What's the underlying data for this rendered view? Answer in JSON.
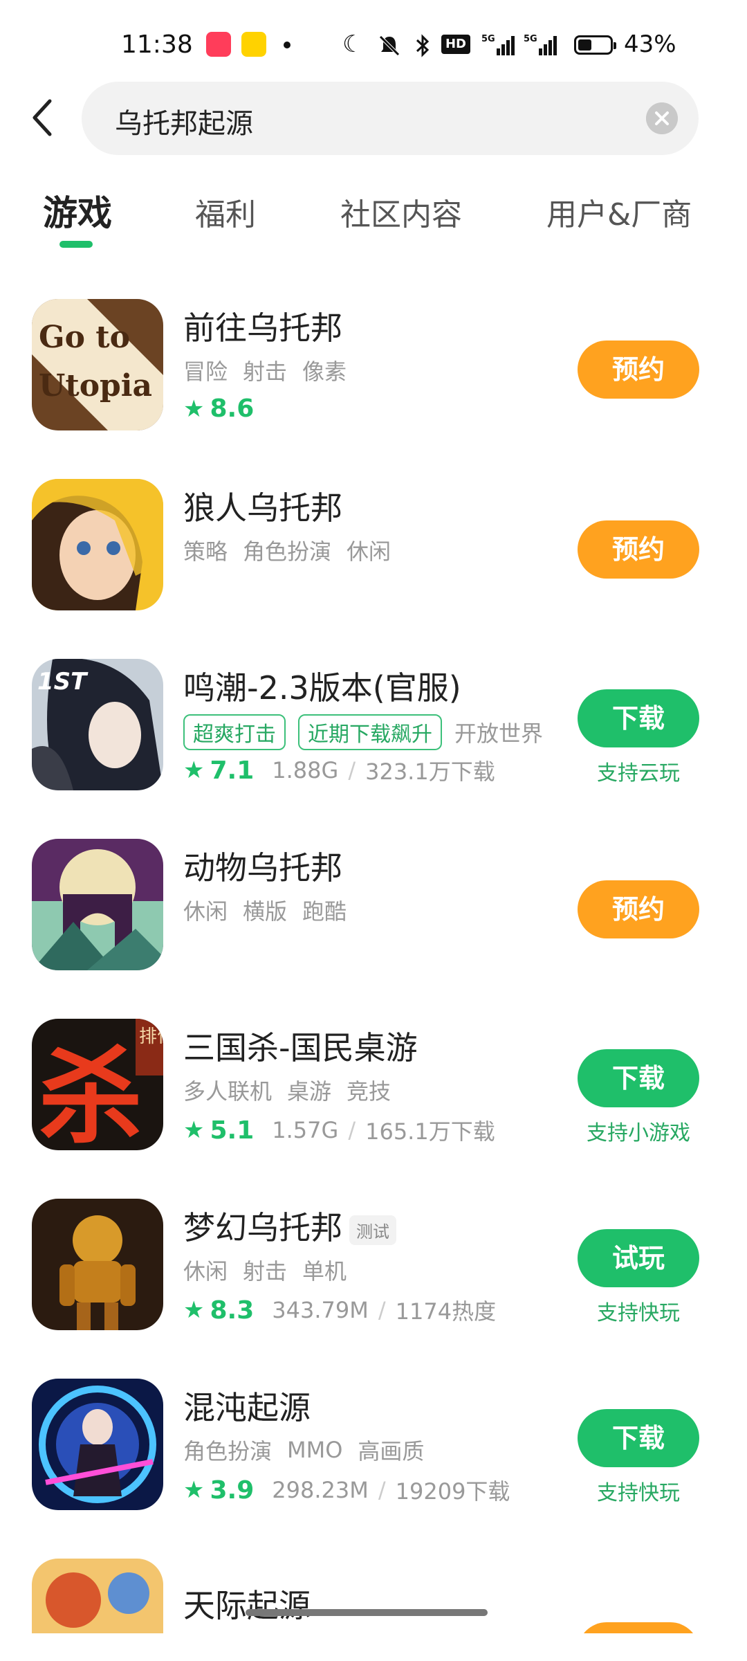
{
  "status_bar": {
    "time": "11:38",
    "hd_label": "HD",
    "battery_level": 0.43,
    "battery_text": "43%"
  },
  "search": {
    "query": "乌托邦起源"
  },
  "tabs": [
    {
      "label": "游戏",
      "active": true
    },
    {
      "label": "福利",
      "active": false
    },
    {
      "label": "社区内容",
      "active": false
    },
    {
      "label": "用户&厂商",
      "active": false
    }
  ],
  "apps": [
    {
      "name": "前往乌托邦",
      "tags": [
        "冒险",
        "射击",
        "像素"
      ],
      "rating": "8.6",
      "button": "预约"
    },
    {
      "name": "狼人乌托邦",
      "tags": [
        "策略",
        "角色扮演",
        "休闲"
      ],
      "button": "预约"
    },
    {
      "name": "鸣潮-2.3版本(官服)",
      "badges": [
        "超爽打击",
        "近期下载飙升"
      ],
      "tags": [
        "开放世界"
      ],
      "rating": "7.1",
      "size": "1.88G",
      "downloads": "323.1万下载",
      "button": "下载",
      "sub": "支持云玩"
    },
    {
      "name": "动物乌托邦",
      "tags": [
        "休闲",
        "横版",
        "跑酷"
      ],
      "button": "预约"
    },
    {
      "name": "三国杀-国民桌游",
      "tags": [
        "多人联机",
        "桌游",
        "竞技"
      ],
      "rating": "5.1",
      "size": "1.57G",
      "downloads": "165.1万下载",
      "button": "下载",
      "sub": "支持小游戏",
      "icon_text": "杀",
      "icon_badge": "排位"
    },
    {
      "name": "梦幻乌托邦",
      "test_badge": "测试",
      "tags": [
        "休闲",
        "射击",
        "单机"
      ],
      "rating": "8.3",
      "size": "343.79M",
      "downloads": "1174热度",
      "button": "试玩",
      "sub": "支持快玩"
    },
    {
      "name": "混沌起源",
      "tags": [
        "角色扮演",
        "MMO",
        "高画质"
      ],
      "rating": "3.9",
      "size": "298.23M",
      "downloads": "19209下载",
      "button": "下载",
      "sub": "支持快玩"
    },
    {
      "name": "天际起源"
    }
  ],
  "icons": {
    "go_to_utopia_text": "Go to Utopia",
    "wuthering_badge": "1ST"
  },
  "colors": {
    "accent_green": "#1fbf6a",
    "reserve_orange": "#ffa21f"
  }
}
